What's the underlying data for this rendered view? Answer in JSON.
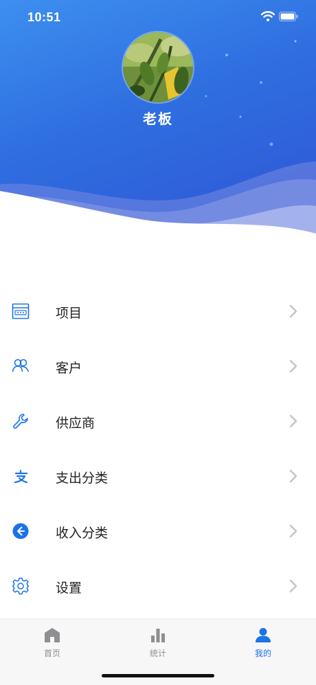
{
  "status_bar": {
    "time": "10:51"
  },
  "profile": {
    "name": "老板"
  },
  "menu": [
    {
      "label": "项目",
      "icon": "project-icon"
    },
    {
      "label": "客户",
      "icon": "customers-icon"
    },
    {
      "label": "供应商",
      "icon": "wrench-icon"
    },
    {
      "label": "支出分类",
      "icon": "expense-icon"
    },
    {
      "label": "收入分类",
      "icon": "income-arrow-icon"
    },
    {
      "label": "设置",
      "icon": "gear-icon"
    }
  ],
  "tabs": [
    {
      "label": "首页",
      "icon": "home-icon",
      "active": false
    },
    {
      "label": "统计",
      "icon": "bar-chart-icon",
      "active": false
    },
    {
      "label": "我的",
      "icon": "user-icon",
      "active": true
    }
  ],
  "colors": {
    "accent": "#1a73e8",
    "header": "#2f6fe0",
    "inactive": "#8e8e93"
  }
}
